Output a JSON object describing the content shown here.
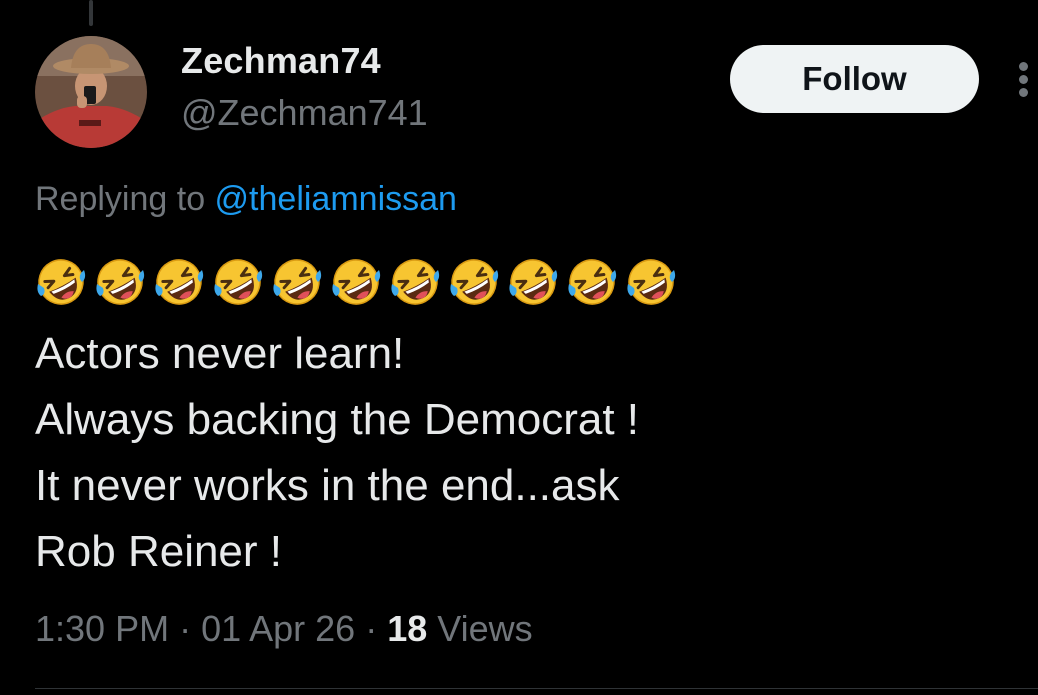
{
  "author": {
    "display_name": "Zechman74",
    "handle": "@Zechman741"
  },
  "follow_label": "Follow",
  "more_icon": "more-vertical-icon",
  "reply": {
    "prefix": "Replying to ",
    "to": "@theliamnissan"
  },
  "tweet": {
    "emoji_name": "rolling-on-the-floor-laughing",
    "emoji_count": 11,
    "lines": [
      "Actors never learn!",
      "Always backing the Democrat !",
      "It never works in the end...ask",
      "Rob Reiner !"
    ]
  },
  "meta": {
    "time": "1:30 PM",
    "separator": " · ",
    "date": "01 Apr 26",
    "views_count": "18",
    "views_label": " Views"
  },
  "colors": {
    "background": "#000000",
    "text": "#e7e9ea",
    "secondary": "#71767b",
    "link": "#1d9bf0",
    "follow_bg": "#eff3f4"
  }
}
